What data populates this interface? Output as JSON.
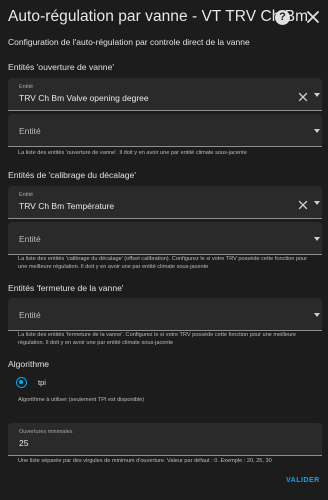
{
  "dialog": {
    "title": "Auto-régulation par vanne - VT TRV Ch Bm",
    "help_icon": "?",
    "description": "Configuration de l'auto-régulation par controle direct de la vanne"
  },
  "opening": {
    "title": "Entités 'ouverture de vanne'",
    "field1_label": "Entité",
    "field1_value": "TRV Ch Bm Valve opening degree",
    "field2_placeholder": "Entité",
    "helper": "La liste des entités 'ouverture de vanne'. Il doit y en avoir une par entité climate sous-jacente"
  },
  "calibration": {
    "title": "Entités de 'calibrage du décalage'",
    "field1_label": "Entité",
    "field1_value": "TRV Ch Bm Température",
    "field2_placeholder": "Entité",
    "helper": "La liste des entités 'calibrage du décalage' (offset calibration). Configurez le si votre TRV possède cette fonction pour une meilleure régulation. Il doit y en avoir une par entité climate sous-jacente"
  },
  "closing": {
    "title": "Entités 'fermeture de la vanne'",
    "field_placeholder": "Entité",
    "helper": "La liste des entités 'fermeture de la vanne'. Configurez le si votre TRV possède cette fonction pour une meilleure régulation. Il doit y en avoir une par entité climate sous-jacente"
  },
  "algorithm": {
    "title": "Algorithme",
    "option_label": "tpi",
    "helper": "Algorithme à utiliser (seulement TPI est disponible)"
  },
  "min_openings": {
    "label": "Ouvertures minimales",
    "value": "25",
    "helper": "Une liste séparée par des virgules de minimum d'ouverture. Valeur par défaut : 0. Exemple : 20, 25, 30"
  },
  "actions": {
    "validate_label": "VALIDER"
  },
  "colors": {
    "background": "#1c1c1c",
    "field": "#2a2a2a",
    "accent": "#03a9f4"
  }
}
